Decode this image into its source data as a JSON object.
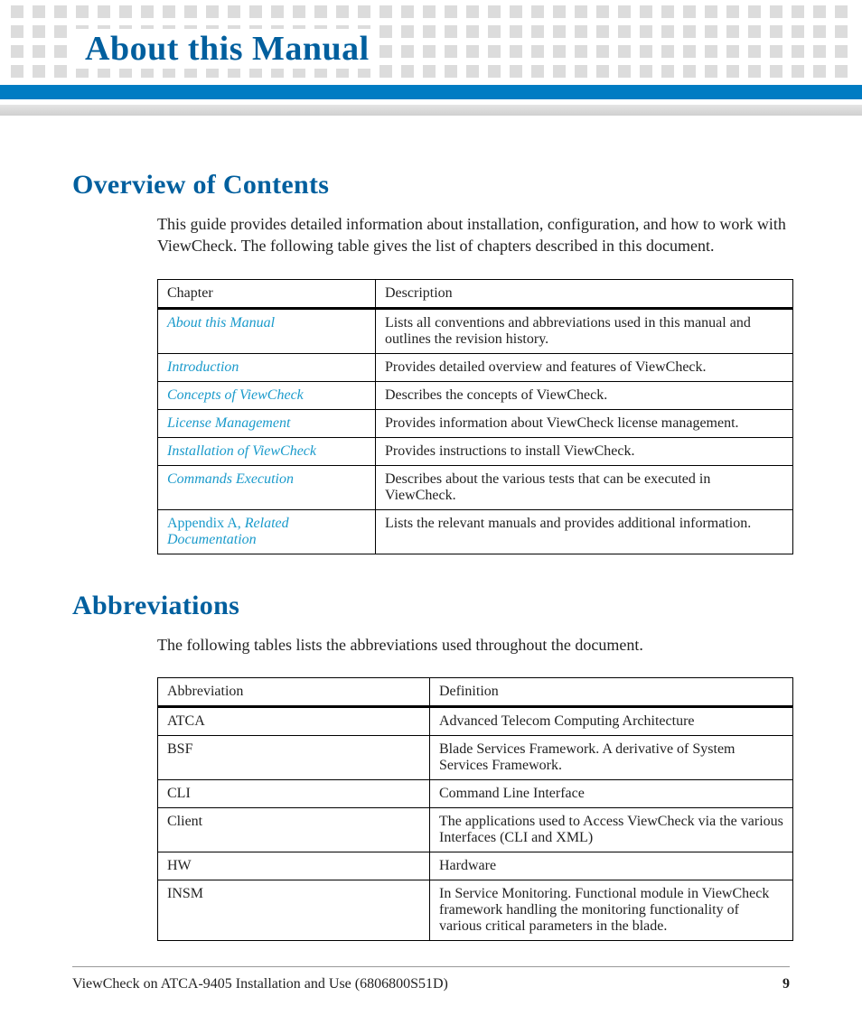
{
  "header": {
    "title": "About this Manual"
  },
  "section1": {
    "heading": "Overview of Contents",
    "paragraph": "This guide provides detailed information about installation, configuration, and how to work with ViewCheck. The following table gives the list of chapters described in this document.",
    "table": {
      "col_chapter": "Chapter",
      "col_description": "Description",
      "rows": [
        {
          "chapter": "About this Manual",
          "desc": "Lists all conventions and abbreviations used in this manual and outlines the revision history."
        },
        {
          "chapter": "Introduction",
          "desc": "Provides detailed overview and features of ViewCheck."
        },
        {
          "chapter": "Concepts of ViewCheck",
          "desc": "Describes the concepts of ViewCheck."
        },
        {
          "chapter": "License Management",
          "desc": "Provides information about ViewCheck license management."
        },
        {
          "chapter": "Installation of ViewCheck",
          "desc": "Provides instructions to install ViewCheck."
        },
        {
          "chapter": "Commands Execution",
          "desc": "Describes about the various tests that can be executed in ViewCheck."
        },
        {
          "chapter_prefix": "Appendix A, ",
          "chapter_link": "Related Documentation",
          "desc": "Lists the relevant manuals and provides additional information."
        }
      ]
    }
  },
  "section2": {
    "heading": "Abbreviations",
    "paragraph": "The following tables lists the abbreviations used throughout the document.",
    "table": {
      "col_abbr": "Abbreviation",
      "col_def": "Definition",
      "rows": [
        {
          "abbr": "ATCA",
          "def": "Advanced Telecom Computing Architecture"
        },
        {
          "abbr": "BSF",
          "def": "Blade Services Framework. A derivative of System Services Framework."
        },
        {
          "abbr": "CLI",
          "def": "Command Line Interface"
        },
        {
          "abbr": "Client",
          "def": "The applications used to Access ViewCheck via the various Interfaces (CLI and XML)"
        },
        {
          "abbr": "HW",
          "def": "Hardware"
        },
        {
          "abbr": "INSM",
          "def": "In Service Monitoring. Functional module in ViewCheck framework handling the monitoring functionality of various critical parameters in the blade."
        }
      ]
    }
  },
  "footer": {
    "doc_title": "ViewCheck on ATCA-9405 Installation and Use (6806800S51D)",
    "page_number": "9"
  }
}
